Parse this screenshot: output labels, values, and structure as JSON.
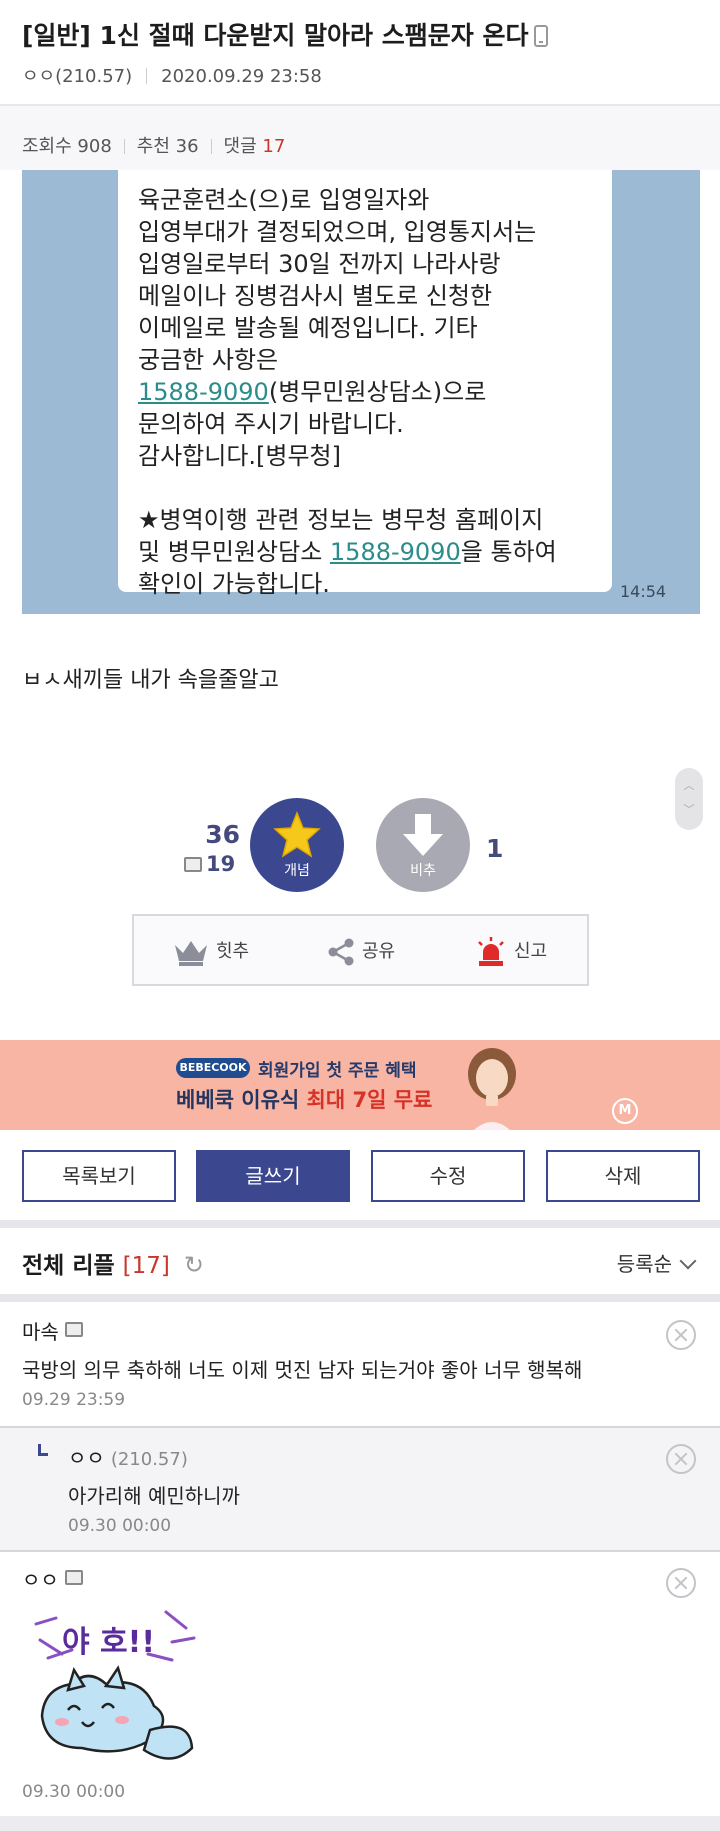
{
  "post": {
    "title": "[일반] 1신 절때 다운받지 말아라 스팸문자 온다",
    "author": "ㅇㅇ(210.57)",
    "date": "2020.09.29 23:58",
    "stats": {
      "views_label": "조회수",
      "views": "908",
      "recommend_label": "추천",
      "recommend": "36",
      "comments_label": "댓글",
      "comments": "17"
    },
    "body_text": "ㅂㅅ새끼들 내가 속을줄알고"
  },
  "message_image": {
    "lines": [
      "육군훈련소(으)로 입영일자와",
      "입영부대가 결정되었으며, 입영통지서는",
      "입영일로부터 30일 전까지 나라사랑",
      "메일이나 징병검사시 별도로 신청한",
      "이메일로 발송될 예정입니다. 기타",
      "궁금한 사항은"
    ],
    "phone": "1588-9090",
    "phone_suffix": "(병무민원상담소)으로",
    "line_after_1": "문의하여 주시기 바랍니다.",
    "line_after_2": "감사합니다.[병무청]",
    "notice_1": "★병역이행 관련 정보는 병무청 홈페이지",
    "notice_2_prefix": "및 병무민원상담소 ",
    "notice_2_phone": "1588-9090",
    "notice_2_suffix": "을 통하여",
    "notice_3": "확인이 가능합니다.",
    "time": "14:54"
  },
  "vote": {
    "up_count": "36",
    "fix_count": "19",
    "up_label": "개념",
    "down_label": "비추",
    "down_count": "1"
  },
  "actions": {
    "hit": "힛추",
    "share": "공유",
    "report": "신고"
  },
  "ad": {
    "brand": "BEBECOOK",
    "line1": "회원가입 첫 주문 혜택",
    "line2_prefix": "베베쿡 이유식 ",
    "line2_highlight": "최대 7일 무료",
    "badge": "M"
  },
  "buttons": {
    "list": "목록보기",
    "write": "글쓰기",
    "edit": "수정",
    "delete": "삭제"
  },
  "comments": {
    "header": "전체 리플",
    "count": "[17]",
    "sort": "등록순",
    "items": [
      {
        "nick": "마속",
        "text": "국방의 의무 축하해 너도 이제 멋진 남자 되는거야 좋아 너무 행복해",
        "date": "09.29 23:59"
      },
      {
        "nick": "ㅇㅇ",
        "ip": "(210.57)",
        "text": "아가리해 예민하니까",
        "date": "09.30 00:00"
      },
      {
        "nick": "ㅇㅇ",
        "dccon_text": "야 호!!",
        "date": "09.30 00:00"
      }
    ]
  },
  "colors": {
    "accent": "#3b4890",
    "highlight_red": "#c8372d",
    "message_bg": "#9cbad4",
    "ad_bg": "#f8b5a4"
  }
}
